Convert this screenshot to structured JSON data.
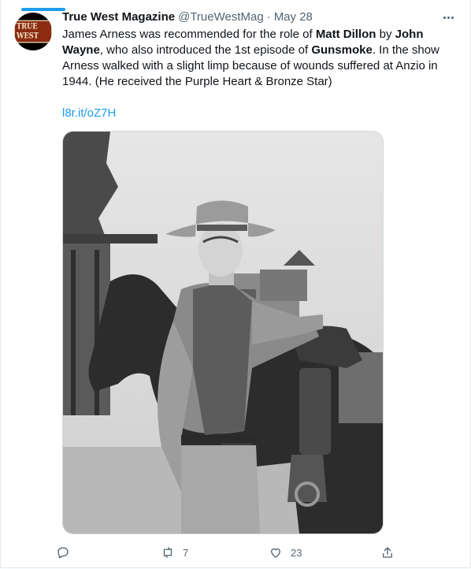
{
  "tweet": {
    "author_name": "True West Magazine",
    "author_handle": "@TrueWestMag",
    "separator": "·",
    "date": "May 28",
    "avatar_text": "TRUE WEST",
    "text_parts": [
      {
        "t": "James Arness was recommended for the role of ",
        "b": false
      },
      {
        "t": "Matt Dillon",
        "b": true
      },
      {
        "t": " by ",
        "b": false
      },
      {
        "t": "John Wayne",
        "b": true
      },
      {
        "t": ", who also introduced the 1st episode of ",
        "b": false
      },
      {
        "t": "Gunsmoke",
        "b": true
      },
      {
        "t": ". In the show Arness walked with a slight limp because of wounds suffered at Anzio in 1944. (He received the Purple Heart & Bronze Star)",
        "b": false
      }
    ],
    "link": "l8r.it/oZ7H"
  },
  "actions": {
    "reply_count": "",
    "retweet_count": "7",
    "like_count": "23"
  },
  "colors": {
    "accent": "#1d9bf0",
    "muted": "#536471",
    "text": "#0f1419"
  }
}
